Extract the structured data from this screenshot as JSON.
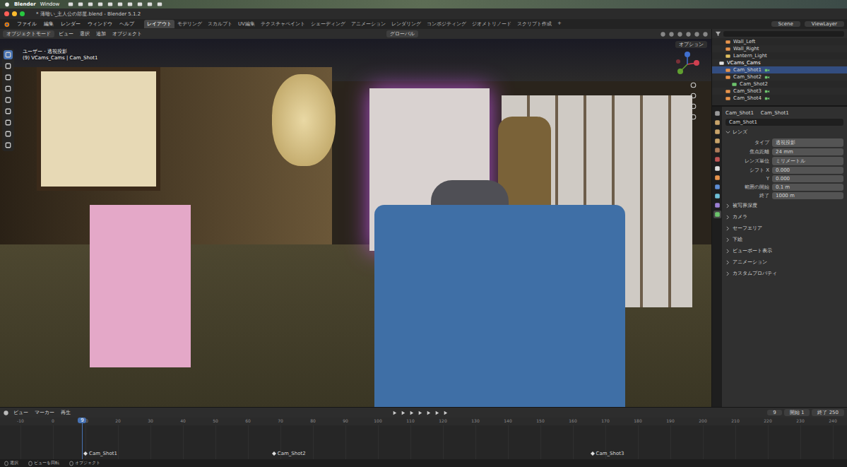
{
  "mac_menubar": {
    "app": "Blender",
    "items": [
      "Window"
    ]
  },
  "window": {
    "title": "* 薄暗い_主人公の部屋.blend - Blender 5.1.2"
  },
  "menu": [
    "ファイル",
    "編集",
    "レンダー",
    "ウィンドウ",
    "ヘルプ"
  ],
  "workspaces": [
    {
      "label": "レイアウト",
      "selected": true
    },
    {
      "label": "モデリング",
      "selected": false
    },
    {
      "label": "スカルプト",
      "selected": false
    },
    {
      "label": "UV編集",
      "selected": false
    },
    {
      "label": "テクスチャペイント",
      "selected": false
    },
    {
      "label": "シェーディング",
      "selected": false
    },
    {
      "label": "アニメーション",
      "selected": false
    },
    {
      "label": "レンダリング",
      "selected": false
    },
    {
      "label": "コンポジティング",
      "selected": false
    },
    {
      "label": "ジオメトリノード",
      "selected": false
    },
    {
      "label": "スクリプト作成",
      "selected": false
    },
    {
      "label": "+",
      "selected": false
    }
  ],
  "scene": "Scene",
  "view_layer": "ViewLayer",
  "viewport": {
    "mode": "オブジェクトモード",
    "menus": [
      "ビュー",
      "選択",
      "追加",
      "オブジェクト"
    ],
    "orientation": "グローバル",
    "options": "オプション",
    "overlay": [
      "ユーザー・透視投影",
      "(9) VCams_Cams | Cam_Shot1"
    ]
  },
  "outliner": {
    "items": [
      {
        "name": "Wall_Left",
        "depth": 2,
        "kind": "object",
        "selected": false
      },
      {
        "name": "Wall_Right",
        "depth": 2,
        "kind": "object",
        "selected": false
      },
      {
        "name": "Lantern_Light",
        "depth": 2,
        "kind": "light",
        "selected": false
      },
      {
        "name": "VCams_Cams",
        "depth": 1,
        "kind": "collection",
        "selected": false
      },
      {
        "name": "Cam_Shot1",
        "depth": 2,
        "kind": "camera",
        "selected": true
      },
      {
        "name": "Cam_Shot2",
        "depth": 2,
        "kind": "camera",
        "selected": false
      },
      {
        "name": "Cam_Shot2",
        "depth": 3,
        "kind": "data",
        "selected": false
      },
      {
        "name": "Cam_Shot3",
        "depth": 2,
        "kind": "camera",
        "selected": false
      },
      {
        "name": "Cam_Shot4",
        "depth": 2,
        "kind": "camera",
        "selected": false
      }
    ]
  },
  "property_tabs": [
    {
      "kind": "tool",
      "selected": false
    },
    {
      "kind": "render",
      "selected": false
    },
    {
      "kind": "output",
      "selected": false
    },
    {
      "kind": "view_layer",
      "selected": false
    },
    {
      "kind": "scene",
      "selected": false
    },
    {
      "kind": "world",
      "selected": false
    },
    {
      "kind": "collection",
      "selected": false
    },
    {
      "kind": "object",
      "selected": false
    },
    {
      "kind": "modifiers",
      "selected": false
    },
    {
      "kind": "physics",
      "selected": false
    },
    {
      "kind": "constraints",
      "selected": false
    },
    {
      "kind": "data",
      "selected": true
    }
  ],
  "properties": {
    "breadcrumb": [
      "Cam_Shot1",
      "Cam_Shot1"
    ],
    "name": "Cam_Shot1",
    "section": "レンズ",
    "fields": [
      {
        "label": "タイプ",
        "value": "透視投影"
      },
      {
        "label": "焦点距離",
        "value": "24 mm"
      },
      {
        "label": "レンズ単位",
        "value": "ミリメートル"
      },
      {
        "label": "シフト X",
        "value": "0.000"
      },
      {
        "label": "Y",
        "value": "0.000"
      },
      {
        "label": "範囲の開始",
        "value": "0.1 m"
      },
      {
        "label": "終了",
        "value": "1000 m"
      }
    ],
    "panels": [
      "被写界深度",
      "カメラ",
      "セーフエリア",
      "下絵",
      "ビューポート表示",
      "アニメーション",
      "カスタムプロパティ"
    ]
  },
  "timeline": {
    "menus": [
      "ビュー",
      "マーカー",
      "再生"
    ],
    "current_frame": "9",
    "start_label": "開始",
    "start": "1",
    "end_label": "終了",
    "end": "250",
    "ticks": [
      "-10",
      "0",
      "10",
      "20",
      "30",
      "40",
      "50",
      "60",
      "70",
      "80",
      "90",
      "100",
      "110",
      "120",
      "130",
      "140",
      "150",
      "160",
      "170",
      "180",
      "190",
      "200",
      "210",
      "220",
      "230",
      "240"
    ],
    "markers": [
      {
        "label": "Cam_Shot1",
        "frame": 10
      },
      {
        "label": "Cam_Shot2",
        "frame": 68
      },
      {
        "label": "Cam_Shot3",
        "frame": 166
      }
    ]
  },
  "status": [
    "選択",
    "ビューを回転",
    "オブジェクト"
  ]
}
